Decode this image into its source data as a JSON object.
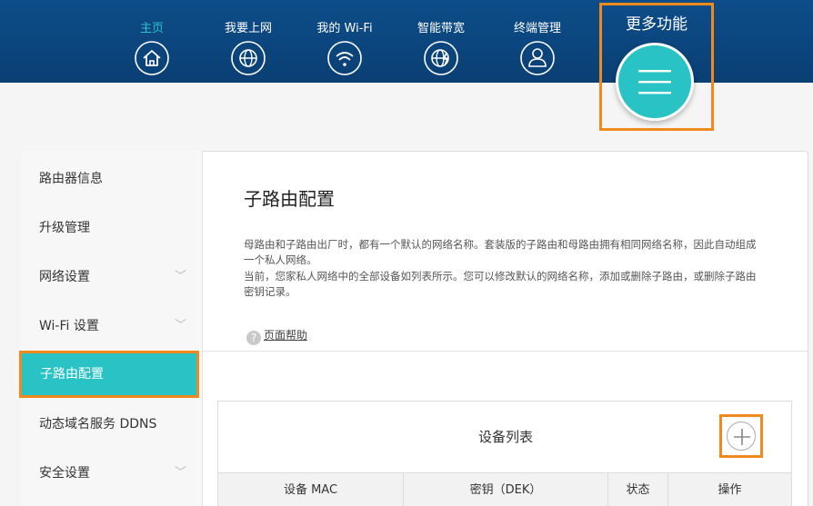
{
  "nav": {
    "items": [
      {
        "label": "主页",
        "icon": "home-icon"
      },
      {
        "label": "我要上网",
        "icon": "globe-icon"
      },
      {
        "label": "我的 Wi-Fi",
        "icon": "wifi-icon"
      },
      {
        "label": "智能带宽",
        "icon": "bandwidth-globe-icon"
      },
      {
        "label": "终端管理",
        "icon": "user-icon"
      }
    ],
    "more_label": "更多功能"
  },
  "sidebar": {
    "items": [
      {
        "label": "路由器信息"
      },
      {
        "label": "升级管理"
      },
      {
        "label": "网络设置"
      },
      {
        "label": "Wi-Fi 设置"
      },
      {
        "label": "子路由配置"
      },
      {
        "label": "动态域名服务 DDNS"
      },
      {
        "label": "安全设置"
      }
    ]
  },
  "content": {
    "title": "子路由配置",
    "desc1": "母路由和子路由出厂时，都有一个默认的网络名称。套装版的子路由和母路由拥有相同网络名称，因此自动组成一个私人网络。",
    "desc2": "当前，您家私人网络中的全部设备如列表所示。您可以修改默认的网络名称，添加或删除子路由，或删除子路由密钥记录。",
    "help": "页面帮助"
  },
  "device_list": {
    "title": "设备列表",
    "columns": [
      "设备 MAC",
      "密钥（DEK）",
      "状态",
      "操作"
    ]
  },
  "colors": {
    "header": "#0d4d8a",
    "accent": "#29c3c6",
    "highlight": "#f08a1c"
  }
}
